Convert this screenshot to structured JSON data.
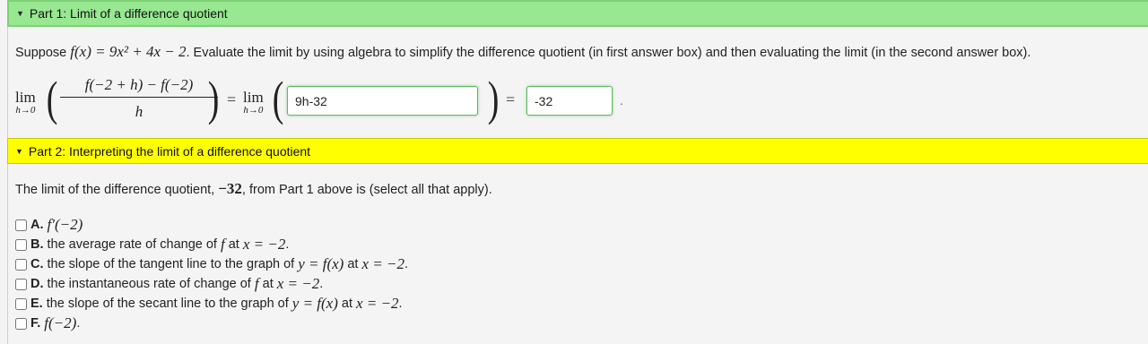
{
  "part1": {
    "header": "Part 1: Limit of a difference quotient",
    "intro_prefix": "Suppose",
    "intro_function": "f(x) = 9x² + 4x − 2",
    "intro_suffix": ". Evaluate the limit by using algebra to simplify the difference quotient (in first answer box) and then evaluating the limit (in the second answer box).",
    "lim_word": "lim",
    "lim_sub": "h→0",
    "numerator": "f(−2 + h) − f(−2)",
    "denominator": "h",
    "equals": "=",
    "answer1": "9h-32",
    "answer2": "-32",
    "trailing": "."
  },
  "part2": {
    "header": "Part 2: Interpreting the limit of a difference quotient",
    "question_prefix": "The limit of the difference quotient,",
    "question_value": "−32",
    "question_suffix": ", from Part 1 above is (select all that apply).",
    "options": [
      {
        "letter": "A.",
        "parts": [
          {
            "m": "f′(−2)"
          }
        ]
      },
      {
        "letter": "B.",
        "parts": [
          {
            "t": "the average rate of change of "
          },
          {
            "m": "f"
          },
          {
            "t": " at "
          },
          {
            "m": "x = −2"
          },
          {
            "t": "."
          }
        ]
      },
      {
        "letter": "C.",
        "parts": [
          {
            "t": "the slope of the tangent line to the graph of "
          },
          {
            "m": "y = f(x)"
          },
          {
            "t": " at "
          },
          {
            "m": "x = −2"
          },
          {
            "t": "."
          }
        ]
      },
      {
        "letter": "D.",
        "parts": [
          {
            "t": "the instantaneous rate of change of "
          },
          {
            "m": "f"
          },
          {
            "t": " at "
          },
          {
            "m": "x = −2"
          },
          {
            "t": "."
          }
        ]
      },
      {
        "letter": "E.",
        "parts": [
          {
            "t": "the slope of the secant line to the graph of "
          },
          {
            "m": "y = f(x)"
          },
          {
            "t": " at "
          },
          {
            "m": "x = −2"
          },
          {
            "t": "."
          }
        ]
      },
      {
        "letter": "F.",
        "parts": [
          {
            "m": "f(−2)"
          },
          {
            "t": "."
          }
        ]
      }
    ]
  }
}
